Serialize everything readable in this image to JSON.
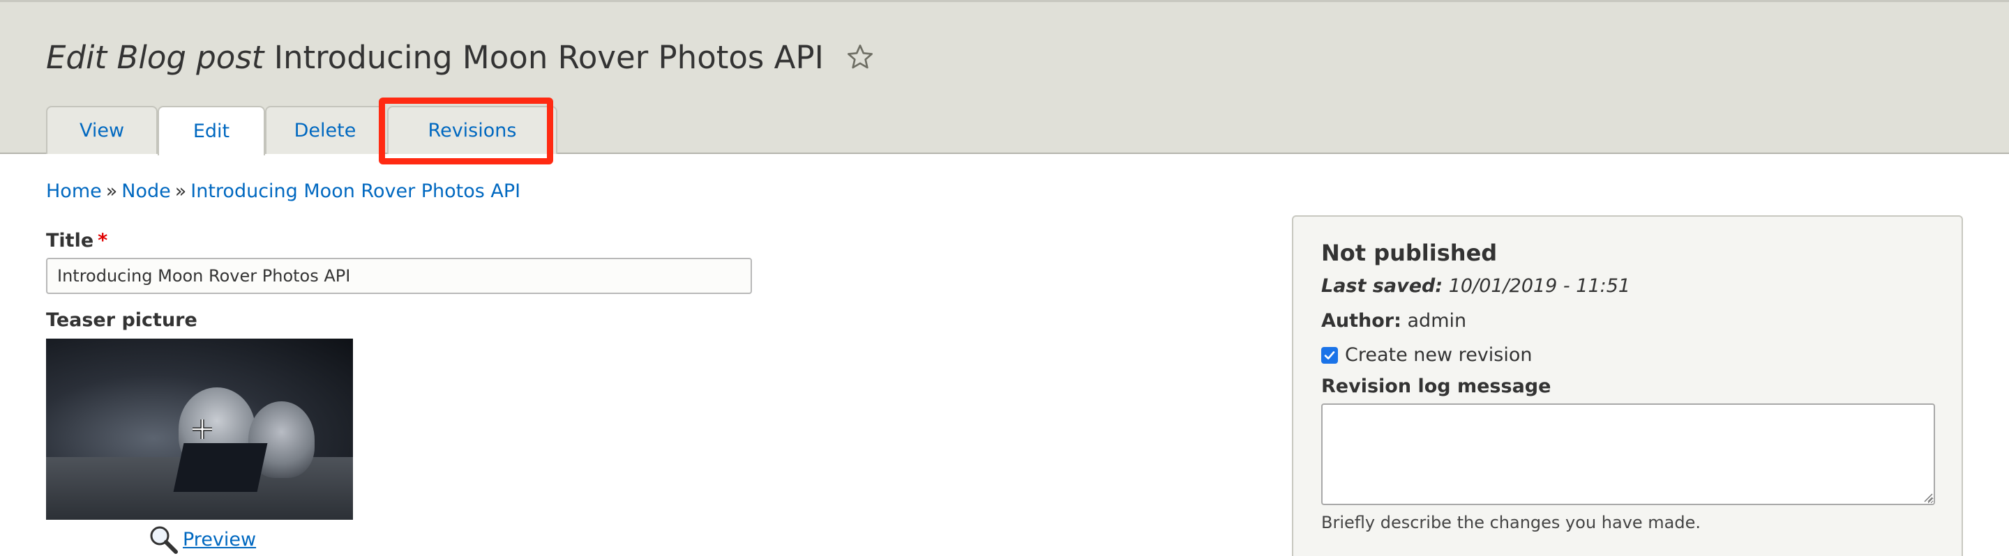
{
  "header": {
    "title_type": "Edit Blog post",
    "title_name": "Introducing Moon Rover Photos API",
    "star_icon": "star-outline-icon"
  },
  "tabs": [
    {
      "label": "View",
      "active": false
    },
    {
      "label": "Edit",
      "active": true
    },
    {
      "label": "Delete",
      "active": false
    },
    {
      "label": "Revisions",
      "active": false
    }
  ],
  "highlight_color": "#ff2a12",
  "breadcrumb": {
    "items": [
      "Home",
      "Node",
      "Introducing Moon Rover Photos API"
    ],
    "separator": "»"
  },
  "form": {
    "title_label": "Title",
    "required_marker": "*",
    "title_value": "Introducing Moon Rover Photos API",
    "teaser_label": "Teaser picture",
    "preview_label": "Preview",
    "preview_icon": "magnifier-icon"
  },
  "meta": {
    "status": "Not published",
    "last_saved_label": "Last saved:",
    "last_saved_value": "10/01/2019 - 11:51",
    "author_label": "Author:",
    "author_value": "admin",
    "create_revision_label": "Create new revision",
    "create_revision_checked": true,
    "revision_log_label": "Revision log message",
    "revision_log_value": "",
    "revision_log_help": "Briefly describe the changes you have made."
  },
  "colors": {
    "link": "#0068c0",
    "header_bg": "#e0e0d8",
    "required": "#e00000",
    "checkbox": "#1a73e8"
  }
}
